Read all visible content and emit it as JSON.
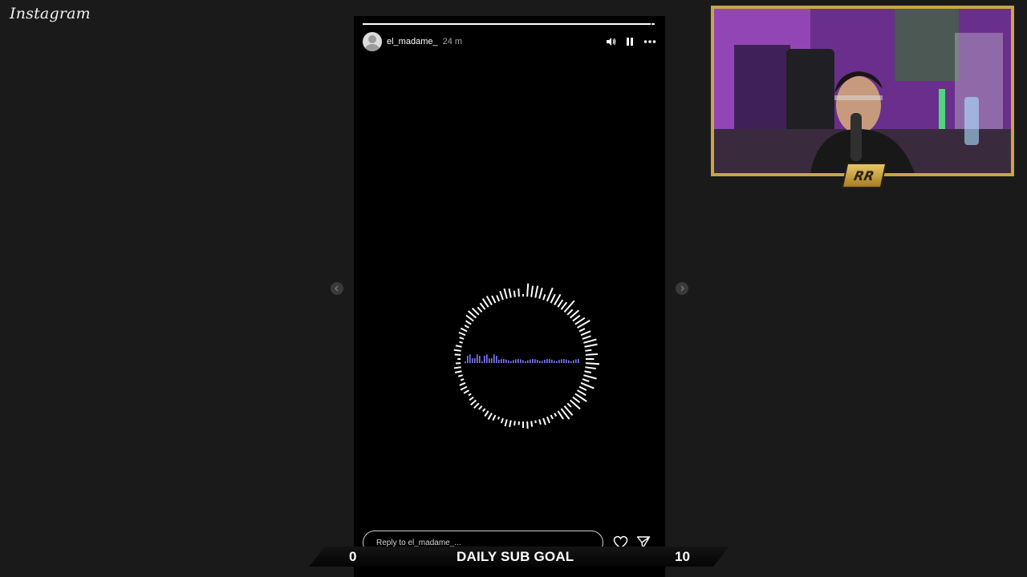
{
  "app": {
    "logo": "Instagram"
  },
  "story": {
    "username": "el_madame_",
    "time": "24 m",
    "progress": 0.98,
    "icons": {
      "mute": "volume-icon",
      "pause": "pause-icon",
      "more": "more-icon",
      "prev": "chevron-left-icon",
      "next": "chevron-right-icon"
    }
  },
  "reply": {
    "placeholder": "Reply to el_madame_...",
    "like_icon": "heart-icon",
    "share_icon": "send-icon"
  },
  "goal": {
    "start": "0",
    "title": "DAILY SUB GOAL",
    "end": "10"
  },
  "webcam": {
    "badge": "RR",
    "frame_color": "#c9a544"
  },
  "colors": {
    "background": "#1a1a1a",
    "story_bg": "#000000",
    "visualizer_ring": "#ffffff",
    "visualizer_wave": "#7d7dff"
  }
}
